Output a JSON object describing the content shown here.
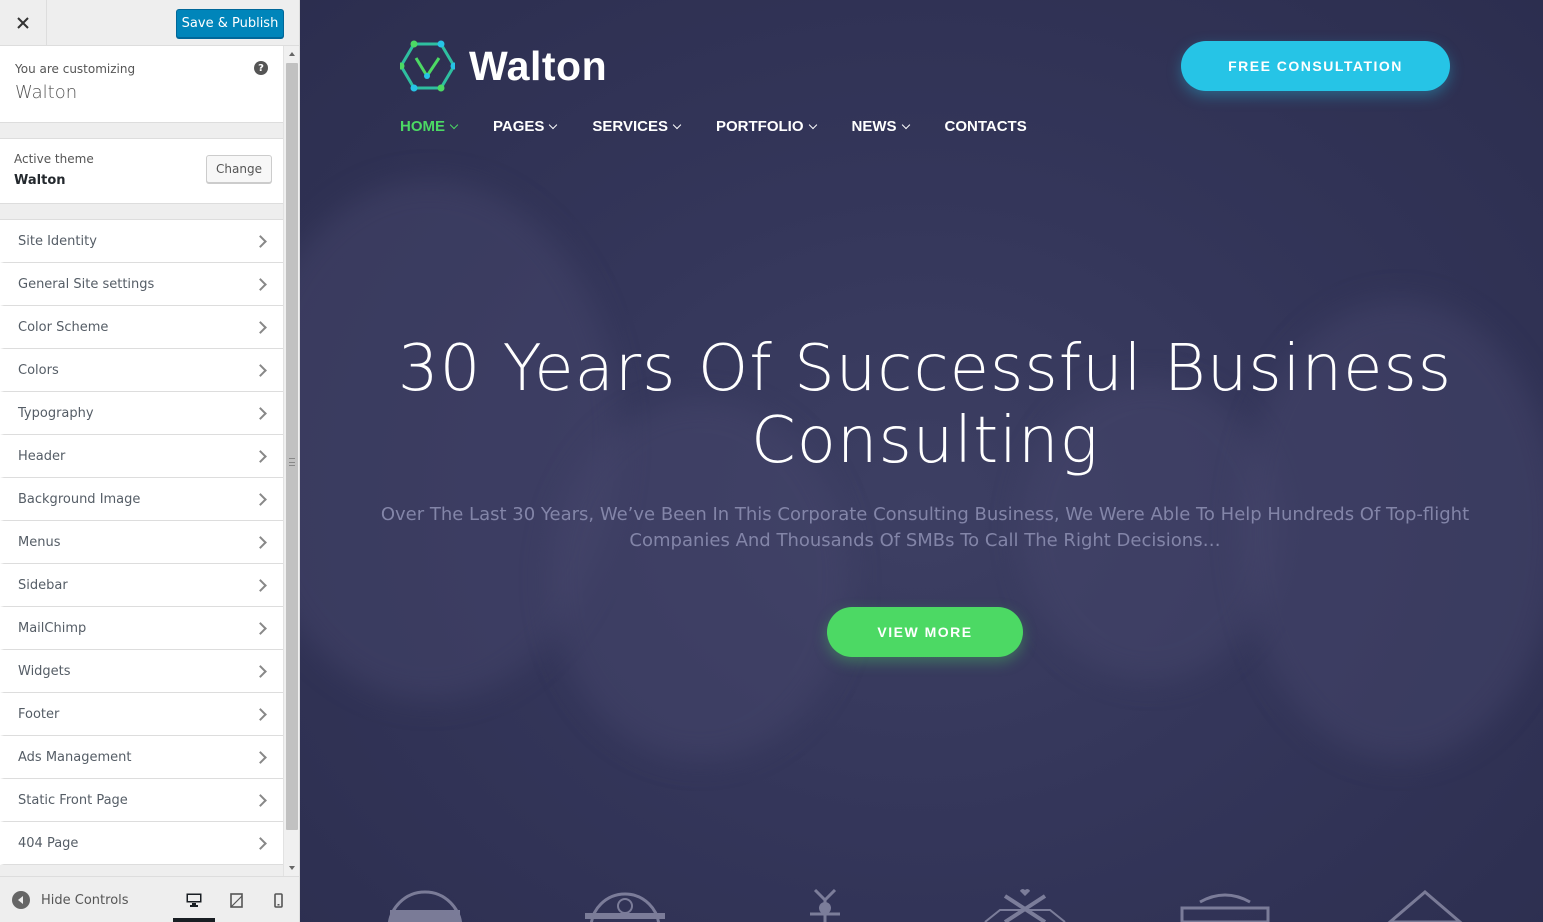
{
  "sidebar": {
    "publish_label": "Save & Publish",
    "customizing_label": "You are customizing",
    "site_title": "Walton",
    "active_theme_label": "Active theme",
    "active_theme_name": "Walton",
    "change_label": "Change",
    "sections": [
      {
        "label": "Site Identity"
      },
      {
        "label": "General Site settings"
      },
      {
        "label": "Color Scheme"
      },
      {
        "label": "Colors"
      },
      {
        "label": "Typography"
      },
      {
        "label": "Header"
      },
      {
        "label": "Background Image"
      },
      {
        "label": "Menus"
      },
      {
        "label": "Sidebar"
      },
      {
        "label": "MailChimp"
      },
      {
        "label": "Widgets"
      },
      {
        "label": "Footer"
      },
      {
        "label": "Ads Management"
      },
      {
        "label": "Static Front Page"
      },
      {
        "label": "404 Page"
      }
    ],
    "hide_controls_label": "Hide Controls",
    "devices": [
      "desktop-icon",
      "tablet-icon",
      "mobile-icon"
    ],
    "accent_color": "#0085ba"
  },
  "preview": {
    "logo_text": "Walton",
    "cta_label": "FREE CONSULTATION",
    "nav": [
      {
        "label": "HOME",
        "active": true,
        "dropdown": true
      },
      {
        "label": "PAGES",
        "active": false,
        "dropdown": true
      },
      {
        "label": "SERVICES",
        "active": false,
        "dropdown": true
      },
      {
        "label": "PORTFOLIO",
        "active": false,
        "dropdown": true
      },
      {
        "label": "NEWS",
        "active": false,
        "dropdown": true
      },
      {
        "label": "CONTACTS",
        "active": false,
        "dropdown": false
      }
    ],
    "hero_title_line1": "30 Years Of Successful Business",
    "hero_title_line2": "Consulting",
    "hero_subtitle_line1": "Over The Last 30 Years, We’ve Been In This Corporate Consulting Business, We Were Able To Help Hundreds Of Top-flight",
    "hero_subtitle_line2": "Companies And Thousands Of SMBs To Call The Right Decisions…",
    "view_more_label": "VIEW MORE",
    "colors": {
      "background": "#34365a",
      "cta": "#26c4e6",
      "accent_green": "#4cd964"
    }
  }
}
